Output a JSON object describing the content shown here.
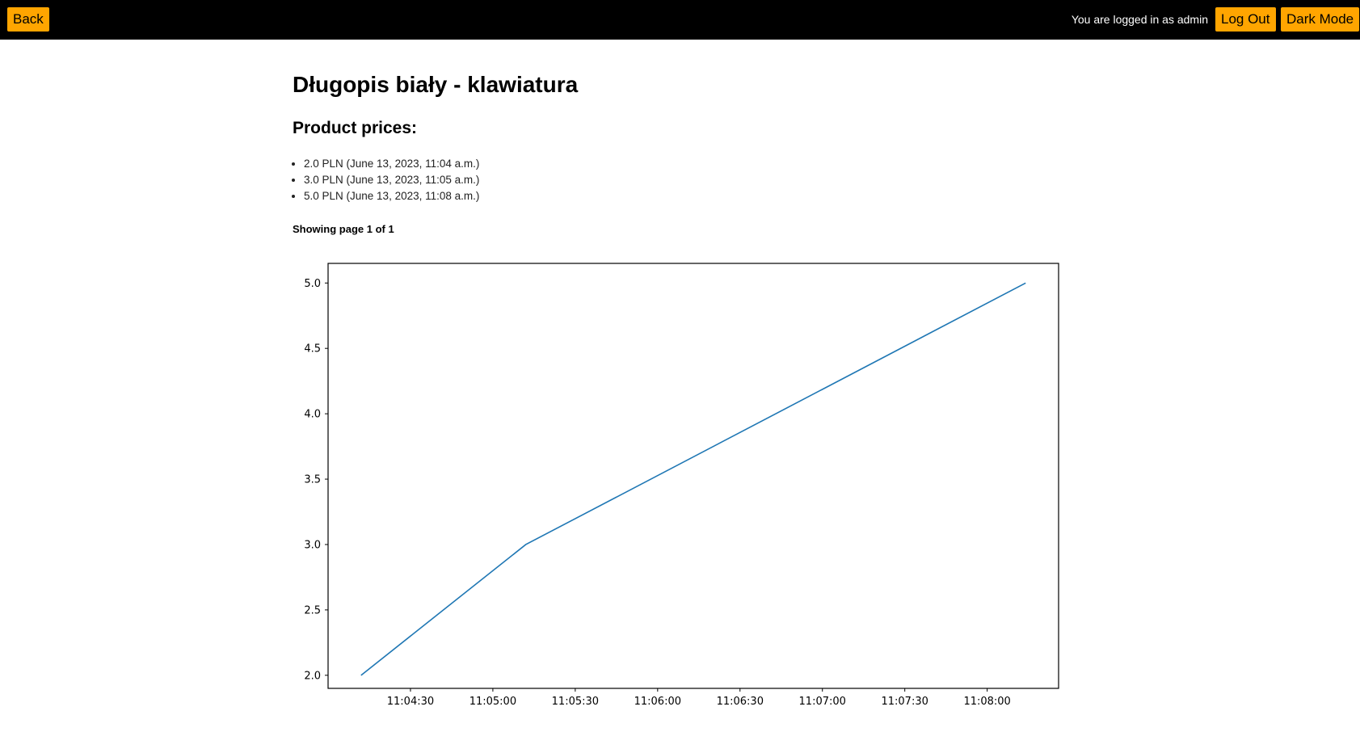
{
  "topbar": {
    "back_label": "Back",
    "login_status": "You are logged in as admin",
    "logout_label": "Log Out",
    "dark_mode_label": "Dark Mode"
  },
  "main": {
    "title": "Długopis biały - klawiatura",
    "prices_heading": "Product prices:",
    "prices": [
      "2.0 PLN (June 13, 2023, 11:04 a.m.)",
      "3.0 PLN (June 13, 2023, 11:05 a.m.)",
      "5.0 PLN (June 13, 2023, 11:08 a.m.)"
    ],
    "paging": "Showing page 1 of 1"
  },
  "colors": {
    "topbar_bg": "#000000",
    "button_bg": "#ffa500",
    "line": "#1f77b4"
  },
  "chart_data": {
    "type": "line",
    "title": "",
    "xlabel": "",
    "ylabel": "",
    "x": [
      "11:04:12",
      "11:05:12",
      "11:08:14"
    ],
    "series": [
      {
        "values": [
          2.0,
          3.0,
          5.0
        ]
      }
    ],
    "xticks": [
      "11:04:30",
      "11:05:00",
      "11:05:30",
      "11:06:00",
      "11:06:30",
      "11:07:00",
      "11:07:30",
      "11:08:00"
    ],
    "yticks": [
      2.0,
      2.5,
      3.0,
      3.5,
      4.0,
      4.5,
      5.0
    ],
    "xlim": [
      "11:04:00",
      "11:08:26"
    ],
    "ylim": [
      1.9,
      5.15
    ],
    "grid": false,
    "legend": "none"
  }
}
